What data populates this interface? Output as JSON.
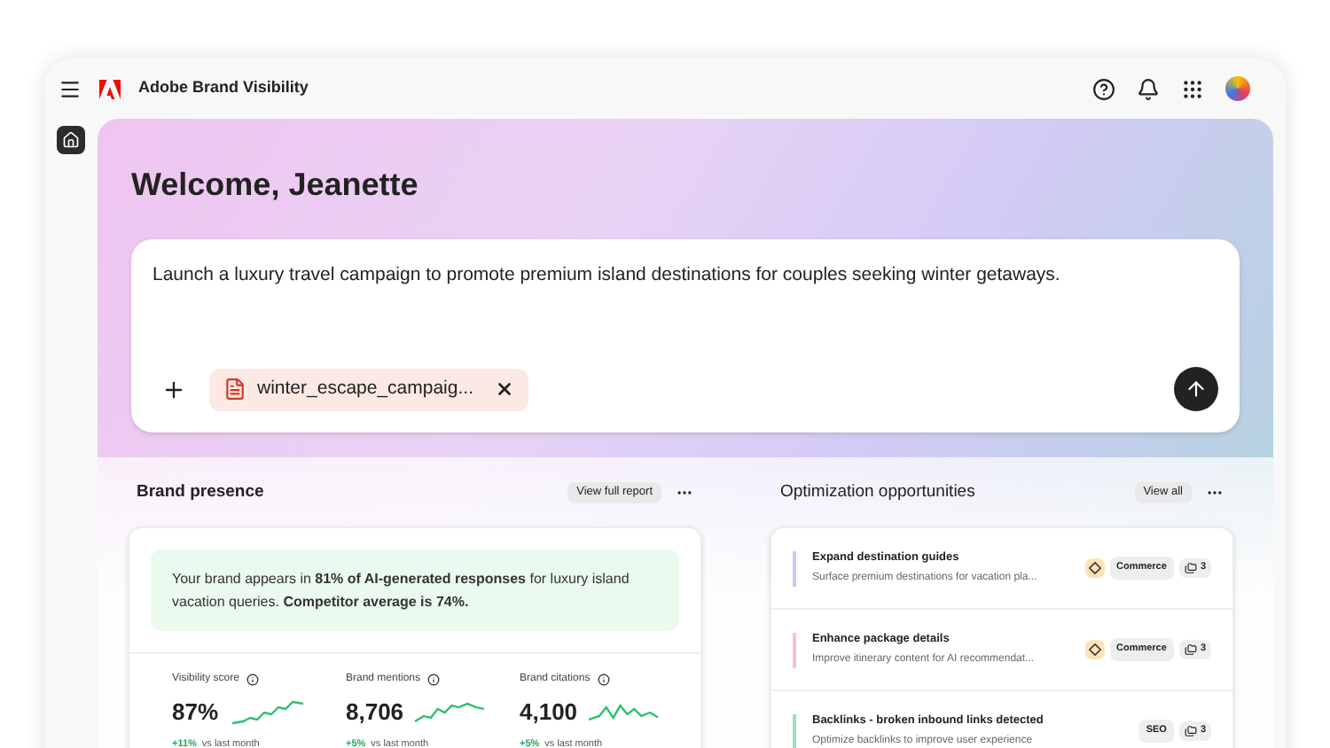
{
  "app": {
    "title": "Adobe Brand Visibility"
  },
  "rail": [
    {
      "selected": true
    }
  ],
  "hero": {
    "greeting": "Welcome, Jeanette",
    "prompt": "Launch a luxury travel campaign to promote premium island destinations for couples seeking winter getaways.",
    "attachment": "winter_escape_campaig..."
  },
  "brand_presence": {
    "title": "Brand presence",
    "action": "View full report",
    "summary": "Your brand appears in **81% of AI-generated responses** for luxury island vacation queries. **Competitor average is 74%.**",
    "metrics": [
      {
        "label": "Visibility score",
        "value": "87%",
        "delta": "+11%",
        "note": "vs last month"
      },
      {
        "label": "Brand mentions",
        "value": "8,706",
        "delta": "+5%",
        "note": "vs last month"
      },
      {
        "label": "Brand citations",
        "value": "4,100",
        "delta": "+5%",
        "note": "vs last month"
      }
    ]
  },
  "opportunities": {
    "title": "Optimization opportunities",
    "action": "View all",
    "items": [
      {
        "title": "Expand destination guides",
        "description": "Surface premium destinations for vacation pla...",
        "color": "#c7c9f5",
        "alert": true,
        "tag": "Commerce",
        "count": "3"
      },
      {
        "title": "Enhance package details",
        "description": "Improve itinerary content for AI recommendat...",
        "color": "#f5c2cf",
        "alert": true,
        "tag": "Commerce",
        "count": "3"
      },
      {
        "title": "Backlinks - broken inbound links detected",
        "description": "Optimize backlinks to improve user experience",
        "color": "#9fe0bd",
        "alert": false,
        "tag": "SEO",
        "count": "3"
      }
    ]
  }
}
